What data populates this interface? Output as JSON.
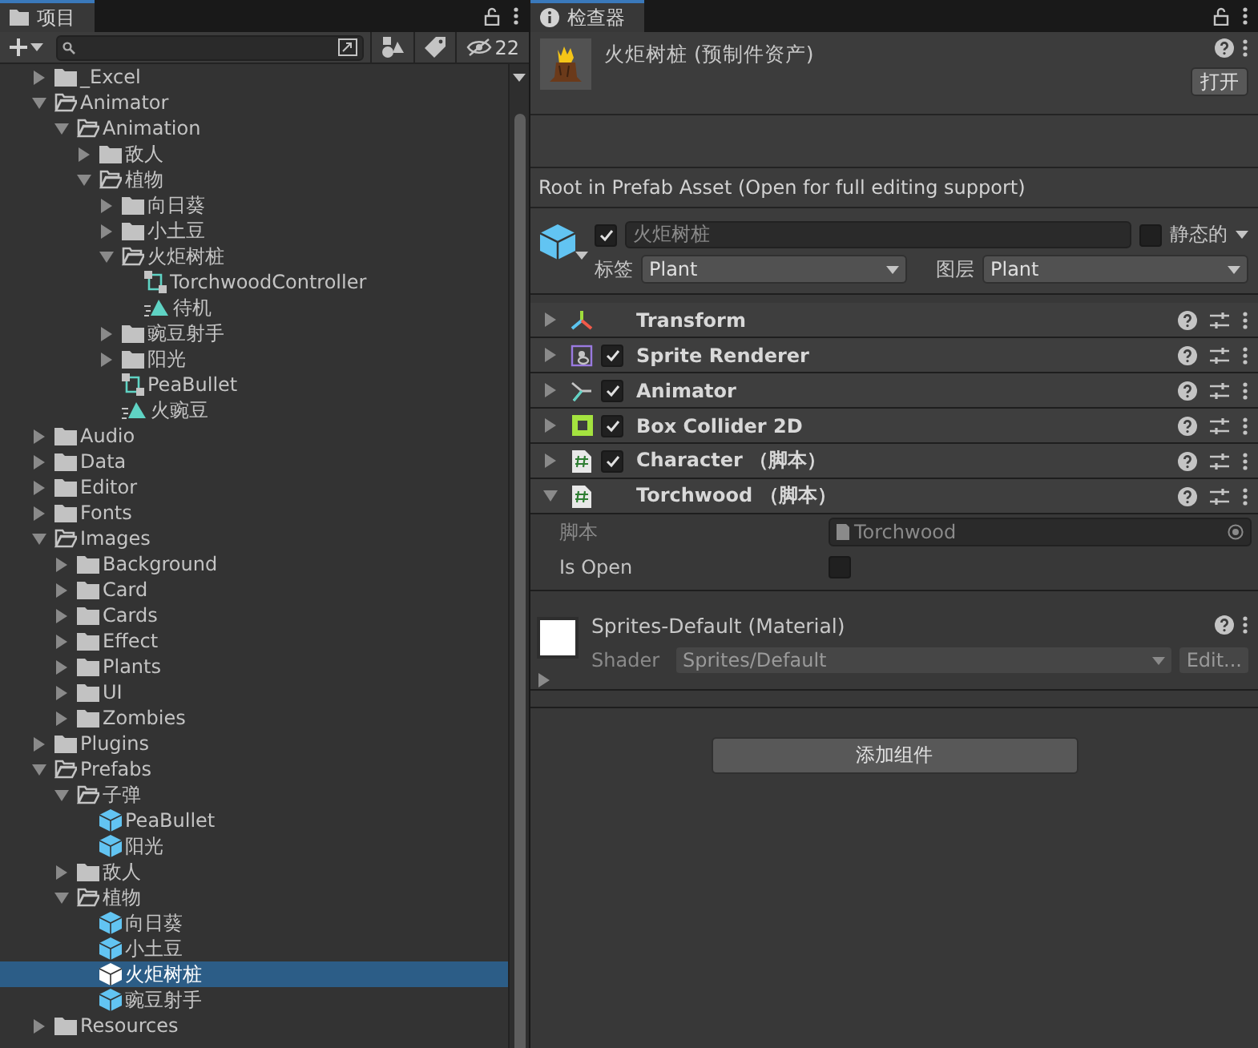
{
  "project": {
    "tab": "项目",
    "hidden_count": "22",
    "tree": [
      {
        "kind": "folder",
        "name": "_Excel",
        "expanded": false,
        "selected": false
      },
      {
        "kind": "folder",
        "name": "Animator",
        "expanded": true,
        "selected": false,
        "children": [
          {
            "kind": "folder",
            "name": "Animation",
            "expanded": true,
            "selected": false,
            "children": [
              {
                "kind": "folder",
                "name": "敌人",
                "expanded": false,
                "selected": false
              },
              {
                "kind": "folder",
                "name": "植物",
                "expanded": true,
                "selected": false,
                "children": [
                  {
                    "kind": "folder",
                    "name": "向日葵",
                    "expanded": false,
                    "selected": false
                  },
                  {
                    "kind": "folder",
                    "name": "小土豆",
                    "expanded": false,
                    "selected": false
                  },
                  {
                    "kind": "folder",
                    "name": "火炬树桩",
                    "expanded": true,
                    "selected": false,
                    "children": [
                      {
                        "kind": "controller",
                        "name": "TorchwoodController",
                        "selected": false
                      },
                      {
                        "kind": "clip",
                        "name": "待机",
                        "selected": false
                      }
                    ]
                  },
                  {
                    "kind": "folder",
                    "name": "豌豆射手",
                    "expanded": false,
                    "selected": false
                  },
                  {
                    "kind": "folder",
                    "name": "阳光",
                    "expanded": false,
                    "selected": false
                  },
                  {
                    "kind": "controller",
                    "name": "PeaBullet",
                    "selected": false
                  },
                  {
                    "kind": "clip",
                    "name": "火豌豆",
                    "selected": false
                  }
                ]
              }
            ]
          }
        ]
      },
      {
        "kind": "folder",
        "name": "Audio",
        "expanded": false,
        "selected": false
      },
      {
        "kind": "folder",
        "name": "Data",
        "expanded": false,
        "selected": false
      },
      {
        "kind": "folder",
        "name": "Editor",
        "expanded": false,
        "selected": false
      },
      {
        "kind": "folder",
        "name": "Fonts",
        "expanded": false,
        "selected": false
      },
      {
        "kind": "folder",
        "name": "Images",
        "expanded": true,
        "selected": false,
        "children": [
          {
            "kind": "folder",
            "name": "Background",
            "expanded": false,
            "selected": false
          },
          {
            "kind": "folder",
            "name": "Card",
            "expanded": false,
            "selected": false
          },
          {
            "kind": "folder",
            "name": "Cards",
            "expanded": false,
            "selected": false
          },
          {
            "kind": "folder",
            "name": "Effect",
            "expanded": false,
            "selected": false
          },
          {
            "kind": "folder",
            "name": "Plants",
            "expanded": false,
            "selected": false
          },
          {
            "kind": "folder",
            "name": "UI",
            "expanded": false,
            "selected": false
          },
          {
            "kind": "folder",
            "name": "Zombies",
            "expanded": false,
            "selected": false
          }
        ]
      },
      {
        "kind": "folder",
        "name": "Plugins",
        "expanded": false,
        "selected": false
      },
      {
        "kind": "folder",
        "name": "Prefabs",
        "expanded": true,
        "selected": false,
        "children": [
          {
            "kind": "folder",
            "name": "子弹",
            "expanded": true,
            "selected": false,
            "children": [
              {
                "kind": "prefab",
                "name": "PeaBullet",
                "selected": false
              },
              {
                "kind": "prefab",
                "name": "阳光",
                "selected": false
              }
            ]
          },
          {
            "kind": "folder",
            "name": "敌人",
            "expanded": false,
            "selected": false
          },
          {
            "kind": "folder",
            "name": "植物",
            "expanded": true,
            "selected": false,
            "children": [
              {
                "kind": "prefab",
                "name": "向日葵",
                "selected": false
              },
              {
                "kind": "prefab",
                "name": "小土豆",
                "selected": false
              },
              {
                "kind": "prefab",
                "name": "火炬树桩",
                "selected": true
              },
              {
                "kind": "prefab",
                "name": "豌豆射手",
                "selected": false
              }
            ]
          }
        ]
      },
      {
        "kind": "folder",
        "name": "Resources",
        "expanded": false,
        "selected": false
      }
    ]
  },
  "inspector": {
    "tab": "检查器",
    "asset_title": "火炬树桩 (预制件资产)",
    "open_button": "打开",
    "notice": "Root in Prefab Asset (Open for full editing support)",
    "object": {
      "active": true,
      "name": "火炬树桩",
      "static_label": "静态的",
      "static": false,
      "tag_label": "标签",
      "tag": "Plant",
      "layer_label": "图层",
      "layer": "Plant"
    },
    "components": [
      {
        "kind": "transform",
        "name": "Transform",
        "expanded": false
      },
      {
        "kind": "sprite",
        "name": "Sprite Renderer",
        "expanded": false,
        "enabled": true
      },
      {
        "kind": "animator",
        "name": "Animator",
        "expanded": false,
        "enabled": true
      },
      {
        "kind": "collider",
        "name": "Box Collider 2D",
        "expanded": false,
        "enabled": true
      },
      {
        "kind": "script",
        "name": "Character （脚本）",
        "expanded": false,
        "enabled": true
      },
      {
        "kind": "script",
        "name": "Torchwood （脚本）",
        "expanded": true
      }
    ],
    "fields": [
      {
        "kind": "object",
        "label": "脚本",
        "value": "Torchwood"
      },
      {
        "kind": "toggle",
        "label": "Is Open",
        "checked": false
      }
    ],
    "material": {
      "name": "Sprites-Default (Material)",
      "expanded": false,
      "shader_label": "Shader",
      "shader": "Sprites/Default",
      "edit_button": "Edit..."
    },
    "add_component": "添加组件"
  }
}
